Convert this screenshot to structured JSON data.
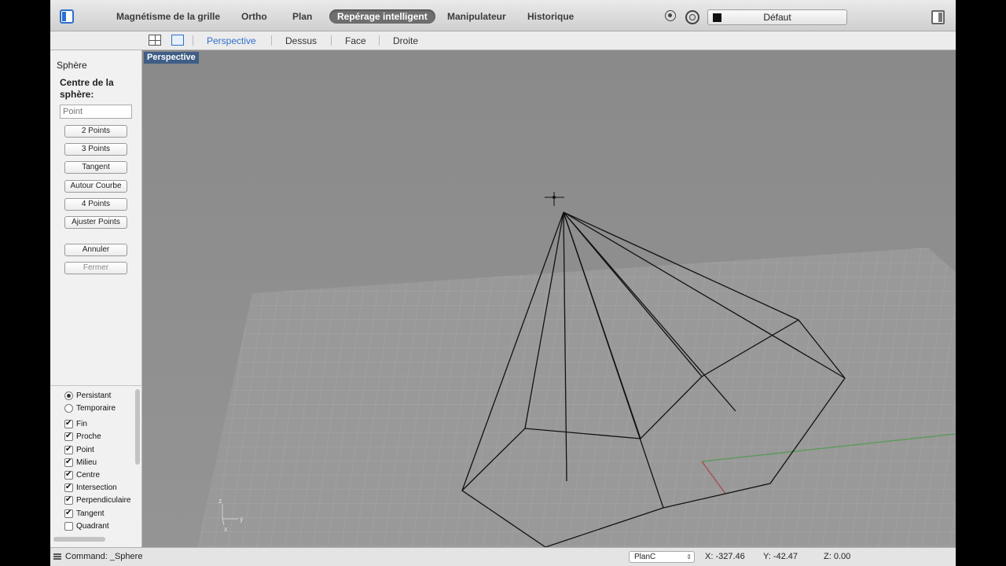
{
  "toolbar": {
    "items": [
      "Magnétisme de la grille",
      "Ortho",
      "Plan",
      "Repérage intelligent",
      "Manipulateur",
      "Historique"
    ],
    "active_index": 3,
    "layer": "Défaut"
  },
  "view_tabs": [
    "Perspective",
    "Dessus",
    "Face",
    "Droite"
  ],
  "viewport_label": "Perspective",
  "command_panel": {
    "title": "Sphère",
    "prompt": "Centre de la sphère:",
    "input_placeholder": "Point",
    "options": [
      "2 Points",
      "3 Points",
      "Tangent",
      "Autour Courbe",
      "4 Points",
      "Ajuster Points"
    ],
    "cancel": "Annuler",
    "close": "Fermer"
  },
  "osnap": {
    "modes": [
      {
        "label": "Persistant",
        "selected": true
      },
      {
        "label": "Temporaire",
        "selected": false
      }
    ],
    "snaps": [
      {
        "label": "Fin",
        "checked": true
      },
      {
        "label": "Proche",
        "checked": true
      },
      {
        "label": "Point",
        "checked": true
      },
      {
        "label": "Milieu",
        "checked": true
      },
      {
        "label": "Centre",
        "checked": true
      },
      {
        "label": "Intersection",
        "checked": true
      },
      {
        "label": "Perpendiculaire",
        "checked": true
      },
      {
        "label": "Tangent",
        "checked": true
      },
      {
        "label": "Quadrant",
        "checked": false
      }
    ]
  },
  "status": {
    "command": "Command: _Sphere",
    "cplane": "PlanC",
    "x": "X: -327.46",
    "y": "Y: -42.47",
    "z": "Z: 0.00"
  },
  "axis_labels": {
    "z": "z",
    "y": "y",
    "x": "x"
  }
}
